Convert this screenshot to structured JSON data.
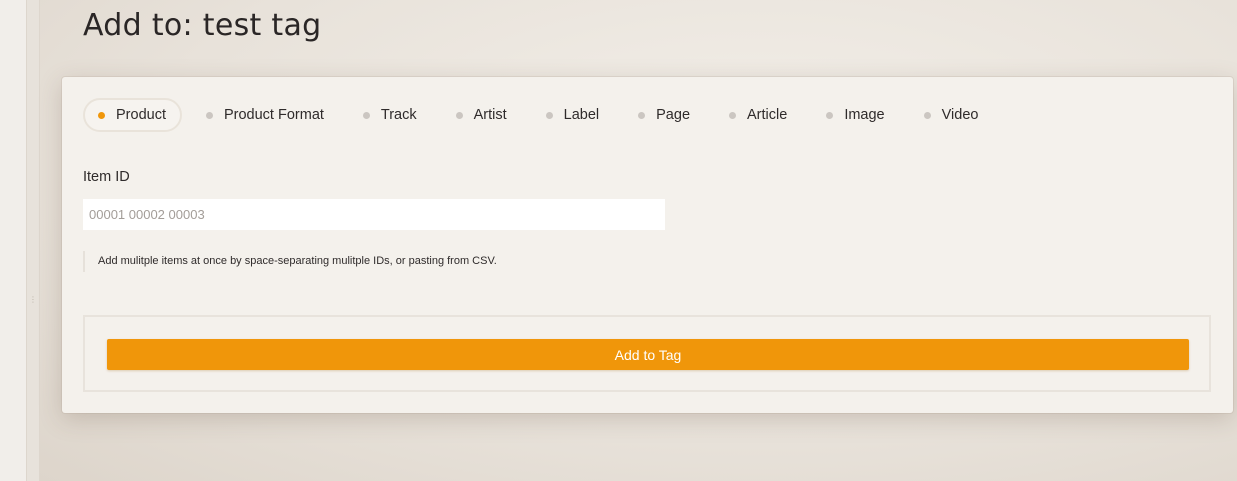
{
  "page": {
    "title": "Add to: test tag"
  },
  "tabs": [
    {
      "label": "Product",
      "active": true
    },
    {
      "label": "Product Format",
      "active": false
    },
    {
      "label": "Track",
      "active": false
    },
    {
      "label": "Artist",
      "active": false
    },
    {
      "label": "Label",
      "active": false
    },
    {
      "label": "Page",
      "active": false
    },
    {
      "label": "Article",
      "active": false
    },
    {
      "label": "Image",
      "active": false
    },
    {
      "label": "Video",
      "active": false
    }
  ],
  "form": {
    "item_id_label": "Item ID",
    "item_id_value": "",
    "item_id_placeholder": "00001 00002 00003",
    "help_text": "Add mulitple items at once by space-separating mulitple IDs, or pasting from CSV.",
    "submit_label": "Add to Tag"
  },
  "colors": {
    "accent": "#f0960a",
    "inactive_dot": "#cbc6c1",
    "card_background": "#f4f1ec",
    "page_background": "#ebe6df"
  }
}
